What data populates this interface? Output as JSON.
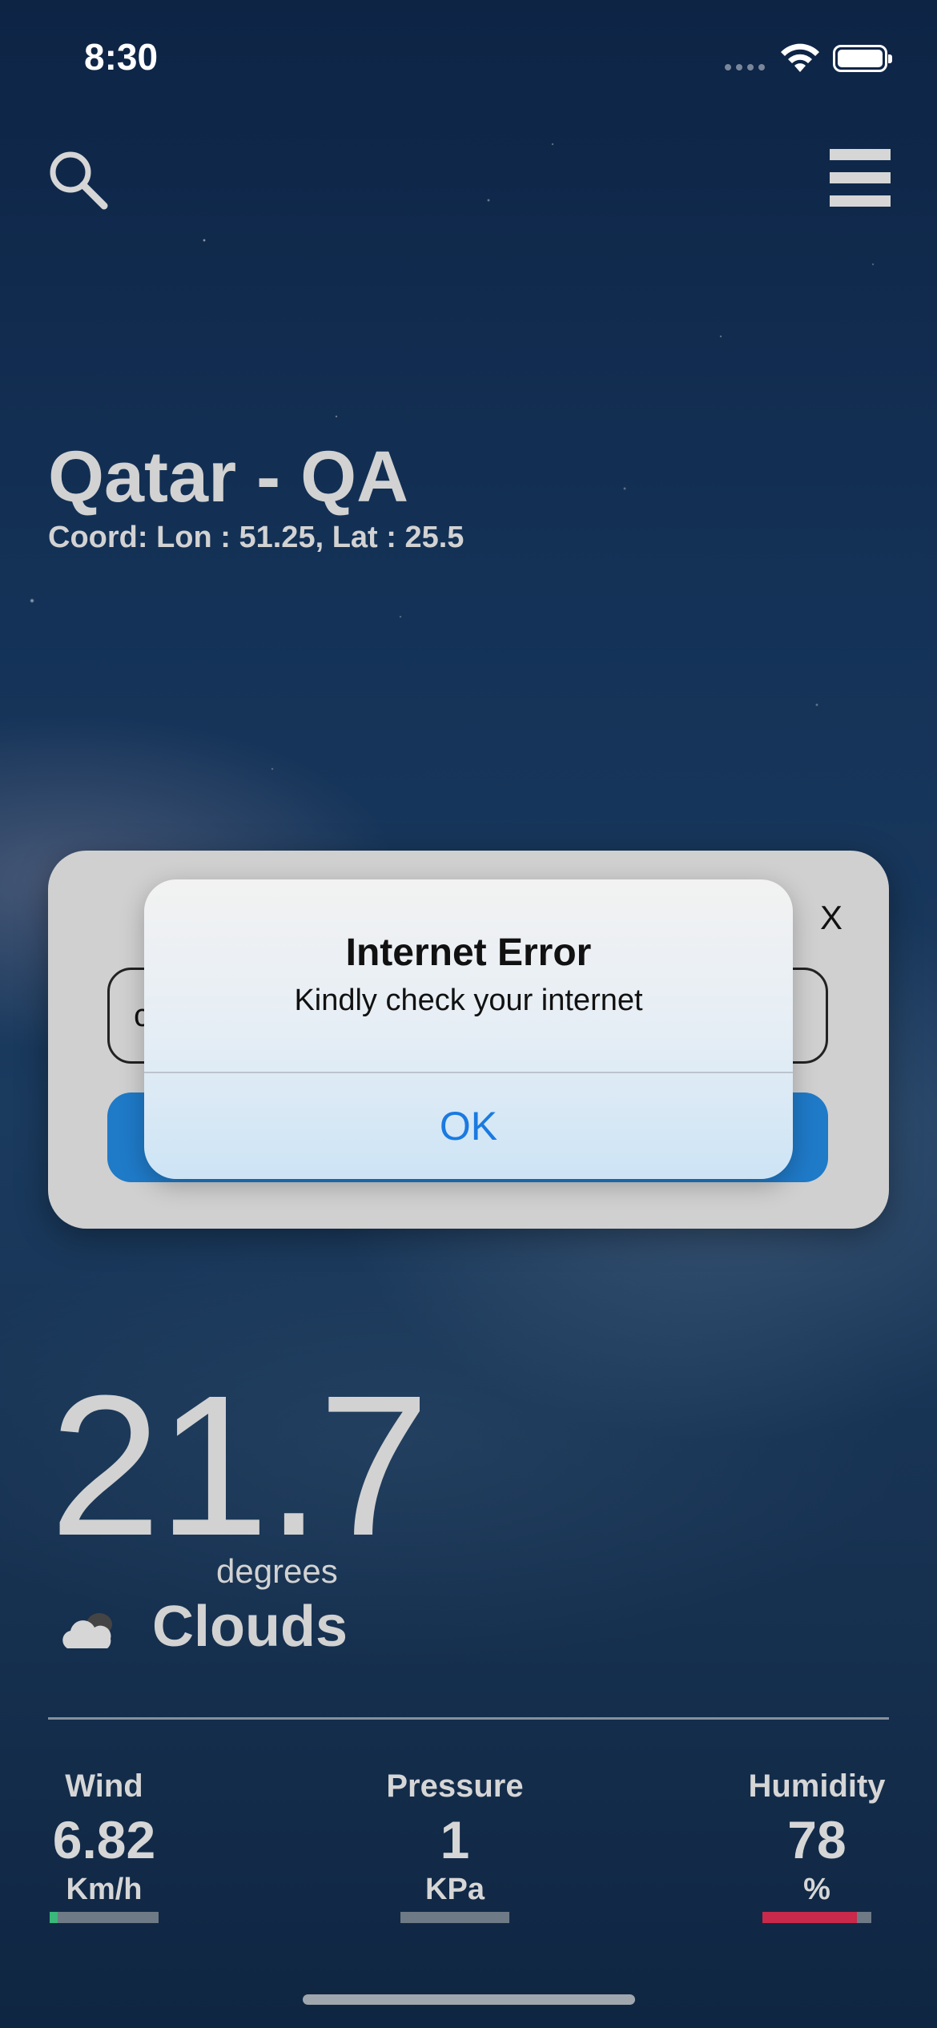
{
  "status_bar": {
    "time": "8:30"
  },
  "header": {
    "search_icon": "search-icon",
    "menu_icon": "hamburger-menu-icon"
  },
  "location": {
    "title": "Qatar - QA",
    "coord": "Coord: Lon : 51.25, Lat : 25.5"
  },
  "search_modal": {
    "close_label": "X",
    "input_value": "c"
  },
  "alert": {
    "title": "Internet Error",
    "message": "Kindly check your internet",
    "ok_label": "OK"
  },
  "weather": {
    "temperature": "21.7",
    "unit": "degrees",
    "condition": "Clouds",
    "condition_icon": "cloud-icon"
  },
  "stats": {
    "wind": {
      "label": "Wind",
      "value": "6.82",
      "unit": "Km/h",
      "level": 0.07,
      "color": "#3ab77a"
    },
    "pressure": {
      "label": "Pressure",
      "value": "1",
      "unit": "KPa",
      "level": 0.0,
      "color": "#3ab77a"
    },
    "humidity": {
      "label": "Humidity",
      "value": "78",
      "unit": "%",
      "level": 0.87,
      "color": "#c9294a"
    }
  },
  "colors": {
    "accent_blue": "#1f7ac8",
    "alert_link": "#1a7ae0"
  }
}
